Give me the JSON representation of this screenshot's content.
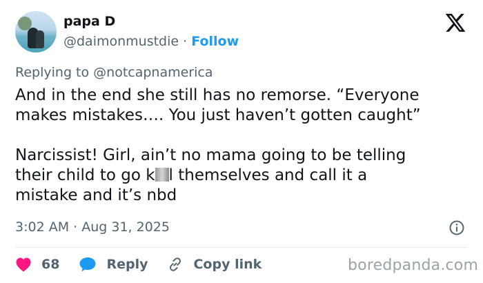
{
  "author": {
    "name": "papa D",
    "handle": "@daimonmustdie",
    "separator": "·",
    "follow_label": "Follow"
  },
  "reply_context": "Replying to @notcapnamerica",
  "body": {
    "line1": "And in the end she still has no remorse. “Everyone\nmakes mistakes…. You just haven’t gotten caught”\n\nNarcissist! Girl, ain’t no mama going to be telling\ntheir child to go k",
    "line2": "l themselves and call it a\nmistake and it’s nbd"
  },
  "timestamp": "3:02 AM · Aug 31, 2025",
  "actions": {
    "likes": "68",
    "reply_label": "Reply",
    "copy_label": "Copy link"
  },
  "watermark": "boredpanda.com",
  "colors": {
    "text": "#0f1419",
    "muted": "#536471",
    "link": "#1d9bf0",
    "like": "#f91880"
  },
  "icons": [
    "x-logo-icon",
    "info-icon",
    "heart-icon",
    "reply-bubble-icon",
    "link-icon"
  ]
}
